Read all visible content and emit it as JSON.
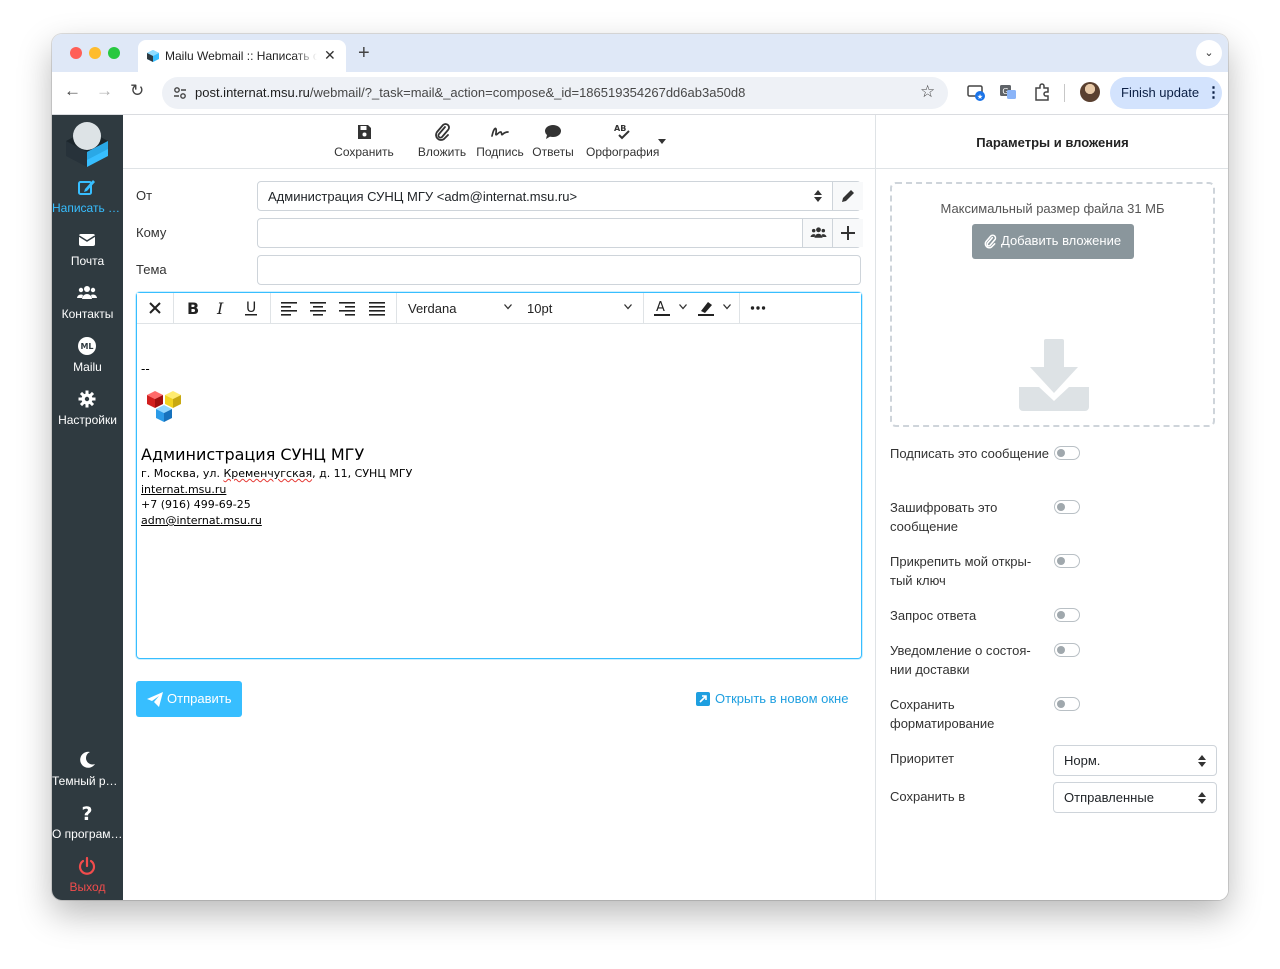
{
  "browser": {
    "tab_title": "Mailu Webmail :: Написать сообщение",
    "url_domain": "post.internat.msu.ru",
    "url_path": "/webmail/?_task=mail&_action=compose&_id=186519354267dd6ab3a50d8",
    "finish_update": "Finish update"
  },
  "sidebar": {
    "compose": "Написать сообщение",
    "mail": "Почта",
    "contacts": "Контакты",
    "mailu": "Mailu",
    "settings": "Настройки",
    "dark_mode": "Темный режим",
    "about": "О программе",
    "logout": "Выход"
  },
  "compose_toolbar": {
    "save": "Сохранить",
    "attach": "Вложить",
    "signature": "Подпись",
    "responses": "Ответы",
    "spell": "Орфография"
  },
  "form": {
    "from_label": "От",
    "from_value": "Администрация СУНЦ МГУ <adm@internat.msu.ru>",
    "to_label": "Кому",
    "to_value": "",
    "subject_label": "Тема",
    "subject_value": ""
  },
  "editor": {
    "font": "Verdana",
    "size": "10pt",
    "signature": {
      "dash": "--",
      "name": "Администрация СУНЦ МГУ",
      "address_start": "г. Москва, ул. ",
      "address_street": "Кременчугская",
      "address_end": ", д. 11, СУНЦ МГУ",
      "site": "internat.msu.ru",
      "phone": "+7 (916) 499-69-25",
      "email": "adm@internat.msu.ru"
    }
  },
  "send": {
    "send_label": "Отправить",
    "open_new": "Открыть в новом окне"
  },
  "right_panel": {
    "title": "Параметры и вложения",
    "max_size": "Максимальный размер файла 31 МБ",
    "add_attachment": "Добавить вложение",
    "options": [
      {
        "label": "Подписать это сообщение",
        "on": false
      },
      {
        "label": "Зашифровать это сообщение",
        "on": false
      },
      {
        "label": "Прикрепить мой откры-тый ключ",
        "on": false
      },
      {
        "label": "Запрос ответа",
        "on": false
      },
      {
        "label": "Уведомление о состоя-нии доставки",
        "on": false
      },
      {
        "label": "Сохранить форматирование",
        "on": false
      }
    ],
    "priority_label": "Приоритет",
    "priority_value": "Норм.",
    "save_in_label": "Сохранить в",
    "save_in_value": "Отправленные"
  },
  "colors": {
    "accent": "#37beff",
    "sidebar": "#2f3a40",
    "logout": "#f24c4c"
  }
}
